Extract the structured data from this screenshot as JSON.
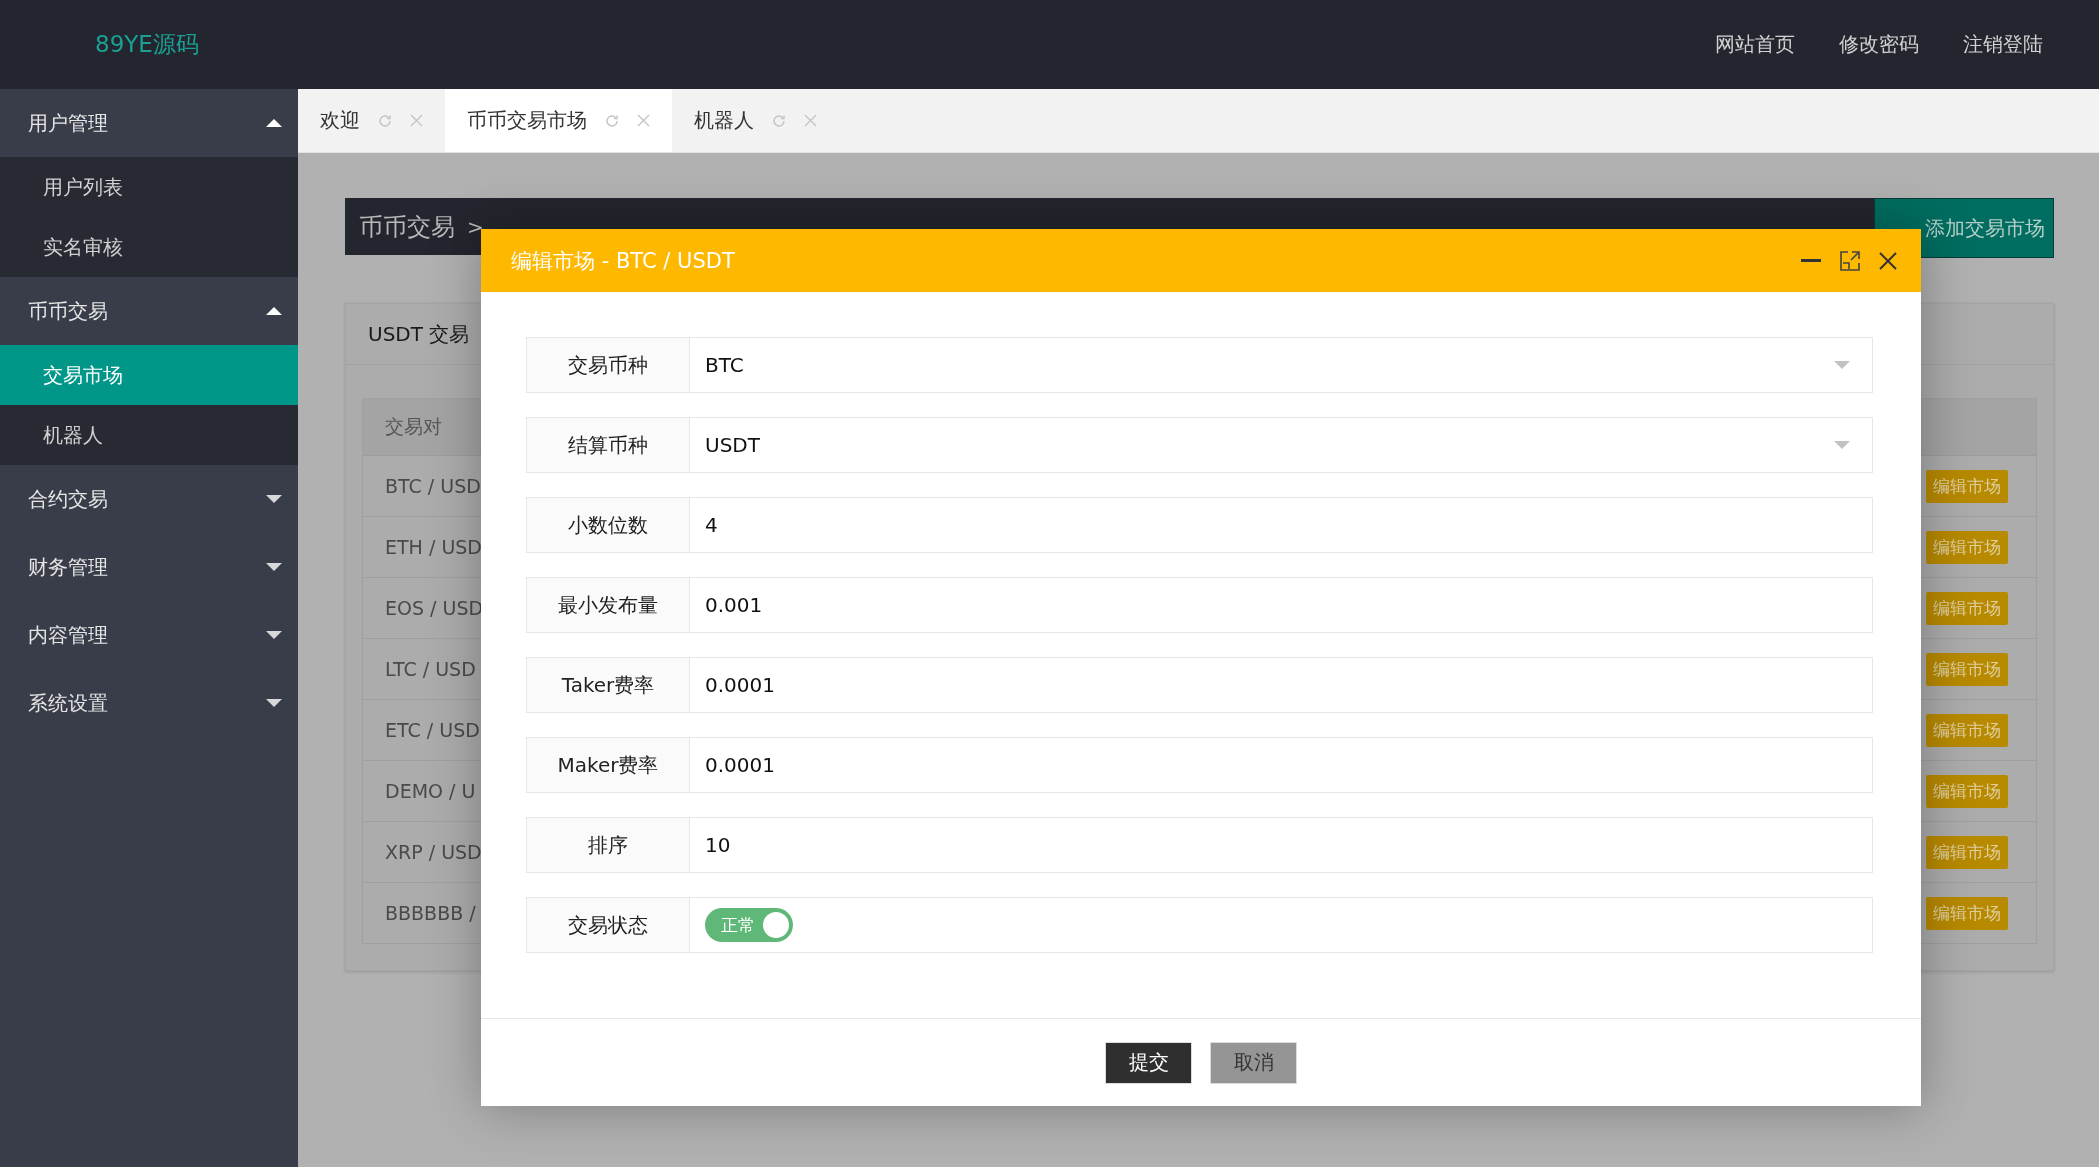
{
  "header": {
    "logo": "89YE源码",
    "links": [
      "网站首页",
      "修改密码",
      "注销登陆"
    ]
  },
  "sidebar": {
    "groups": [
      {
        "label": "用户管理",
        "expanded": true,
        "items": [
          {
            "label": "用户列表",
            "selected": false
          },
          {
            "label": "实名审核",
            "selected": false
          }
        ]
      },
      {
        "label": "币币交易",
        "expanded": true,
        "items": [
          {
            "label": "交易市场",
            "selected": true
          },
          {
            "label": "机器人",
            "selected": false
          }
        ]
      },
      {
        "label": "合约交易",
        "expanded": false
      },
      {
        "label": "财务管理",
        "expanded": false
      },
      {
        "label": "内容管理",
        "expanded": false
      },
      {
        "label": "系统设置",
        "expanded": false
      }
    ]
  },
  "tabs": [
    {
      "label": "欢迎",
      "selected": false
    },
    {
      "label": "币币交易市场",
      "selected": true
    },
    {
      "label": "机器人",
      "selected": false
    }
  ],
  "breadcrumb": {
    "section": "币币交易",
    "separator": ">"
  },
  "add_button": "添加交易市场",
  "card": {
    "title": "USDT 交易",
    "table": {
      "columns": [
        "交易对"
      ],
      "rows": [
        {
          "pair": "BTC / USD",
          "action": "编辑市场"
        },
        {
          "pair": "ETH / USD",
          "action": "编辑市场"
        },
        {
          "pair": "EOS / USD",
          "action": "编辑市场"
        },
        {
          "pair": "LTC / USD",
          "action": "编辑市场"
        },
        {
          "pair": "ETC / USD",
          "action": "编辑市场"
        },
        {
          "pair": "DEMO / U",
          "action": "编辑市场"
        },
        {
          "pair": "XRP / USD",
          "action": "编辑市场"
        },
        {
          "pair": "BBBBBB /",
          "action": "编辑市场"
        }
      ]
    }
  },
  "modal": {
    "title": "编辑市场 - BTC / USDT",
    "fields": [
      {
        "kind": "select",
        "label": "交易币种",
        "value": "BTC"
      },
      {
        "kind": "select",
        "label": "结算币种",
        "value": "USDT"
      },
      {
        "kind": "input",
        "label": "小数位数",
        "value": "4"
      },
      {
        "kind": "input",
        "label": "最小发布量",
        "value": "0.001"
      },
      {
        "kind": "input",
        "label": "Taker费率",
        "value": "0.0001"
      },
      {
        "kind": "input",
        "label": "Maker费率",
        "value": "0.0001"
      },
      {
        "kind": "input",
        "label": "排序",
        "value": "10"
      },
      {
        "kind": "switch",
        "label": "交易状态",
        "on": true,
        "text": "正常"
      }
    ],
    "buttons": [
      {
        "kind": "primary",
        "label": "提交"
      },
      {
        "kind": "secondary",
        "label": "取消"
      }
    ]
  }
}
